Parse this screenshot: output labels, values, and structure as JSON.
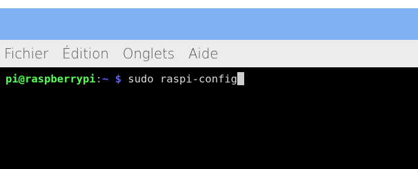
{
  "colors": {
    "title_bar": "#7fb1f4",
    "menu_bar": "#ececec",
    "terminal_bg": "#000000",
    "prompt_user": "#55ff55",
    "prompt_path": "#5c5cff",
    "command_text": "#d8d8d8"
  },
  "menu": {
    "items": [
      {
        "label": "Fichier"
      },
      {
        "label": "Édition"
      },
      {
        "label": "Onglets"
      },
      {
        "label": "Aide"
      }
    ]
  },
  "terminal": {
    "user_host": "pi@raspberrypi",
    "separator": ":",
    "path": "~",
    "prompt_symbol": "$",
    "command": "sudo raspi-config"
  }
}
